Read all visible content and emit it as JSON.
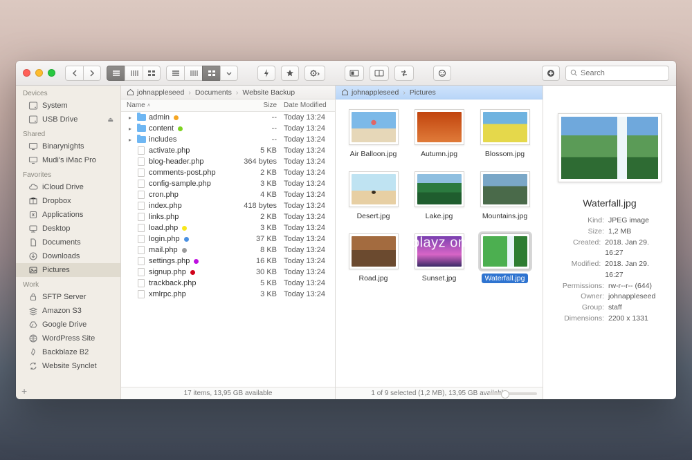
{
  "search": {
    "placeholder": "Search"
  },
  "sidebar": {
    "sections": [
      {
        "label": "Devices",
        "items": [
          {
            "name": "system",
            "label": "System",
            "icon": "drive"
          },
          {
            "name": "usb",
            "label": "USB Drive",
            "icon": "drive",
            "eject": true
          }
        ]
      },
      {
        "label": "Shared",
        "items": [
          {
            "name": "binarynights",
            "label": "Binarynights",
            "icon": "display"
          },
          {
            "name": "mudi-imac",
            "label": "Mudi's iMac Pro",
            "icon": "display"
          }
        ]
      },
      {
        "label": "Favorites",
        "items": [
          {
            "name": "icloud",
            "label": "iCloud Drive",
            "icon": "cloud"
          },
          {
            "name": "dropbox",
            "label": "Dropbox",
            "icon": "box"
          },
          {
            "name": "apps",
            "label": "Applications",
            "icon": "app"
          },
          {
            "name": "desktop",
            "label": "Desktop",
            "icon": "desktop"
          },
          {
            "name": "documents",
            "label": "Documents",
            "icon": "doc"
          },
          {
            "name": "downloads",
            "label": "Downloads",
            "icon": "down"
          },
          {
            "name": "pictures",
            "label": "Pictures",
            "icon": "pic",
            "selected": true
          }
        ]
      },
      {
        "label": "Work",
        "items": [
          {
            "name": "sftp",
            "label": "SFTP Server",
            "icon": "lock"
          },
          {
            "name": "s3",
            "label": "Amazon S3",
            "icon": "stack"
          },
          {
            "name": "gdrive",
            "label": "Google Drive",
            "icon": "gdrive"
          },
          {
            "name": "wp",
            "label": "WordPress Site",
            "icon": "globe"
          },
          {
            "name": "backblaze",
            "label": "Backblaze B2",
            "icon": "flame"
          },
          {
            "name": "synclet",
            "label": "Website Synclet",
            "icon": "sync"
          }
        ]
      }
    ]
  },
  "left_pane": {
    "breadcrumbs": [
      "johnappleseed",
      "Documents",
      "Website Backup"
    ],
    "columns": {
      "name": "Name",
      "size": "Size",
      "date": "Date Modified"
    },
    "rows": [
      {
        "type": "folder",
        "name": "admin",
        "size": "--",
        "date": "Today 13:24",
        "tag": "#f5a623"
      },
      {
        "type": "folder",
        "name": "content",
        "size": "--",
        "date": "Today 13:24",
        "tag": "#7ed321"
      },
      {
        "type": "folder",
        "name": "includes",
        "size": "--",
        "date": "Today 13:24"
      },
      {
        "type": "file",
        "name": "activate.php",
        "size": "5 KB",
        "date": "Today 13:24"
      },
      {
        "type": "file",
        "name": "blog-header.php",
        "size": "364 bytes",
        "date": "Today 13:24"
      },
      {
        "type": "file",
        "name": "comments-post.php",
        "size": "2 KB",
        "date": "Today 13:24"
      },
      {
        "type": "file",
        "name": "config-sample.php",
        "size": "3 KB",
        "date": "Today 13:24"
      },
      {
        "type": "file",
        "name": "cron.php",
        "size": "4 KB",
        "date": "Today 13:24"
      },
      {
        "type": "file",
        "name": "index.php",
        "size": "418 bytes",
        "date": "Today 13:24"
      },
      {
        "type": "file",
        "name": "links.php",
        "size": "2 KB",
        "date": "Today 13:24"
      },
      {
        "type": "file",
        "name": "load.php",
        "size": "3 KB",
        "date": "Today 13:24",
        "tag": "#f8e71c"
      },
      {
        "type": "file",
        "name": "login.php",
        "size": "37 KB",
        "date": "Today 13:24",
        "tag": "#4a90e2"
      },
      {
        "type": "file",
        "name": "mail.php",
        "size": "8 KB",
        "date": "Today 13:24",
        "tag": "#9b9b9b"
      },
      {
        "type": "file",
        "name": "settings.php",
        "size": "16 KB",
        "date": "Today 13:24",
        "tag": "#bd10e0"
      },
      {
        "type": "file",
        "name": "signup.php",
        "size": "30 KB",
        "date": "Today 13:24",
        "tag": "#d0021b"
      },
      {
        "type": "file",
        "name": "trackback.php",
        "size": "5 KB",
        "date": "Today 13:24"
      },
      {
        "type": "file",
        "name": "xmlrpc.php",
        "size": "3 KB",
        "date": "Today 13:24"
      }
    ],
    "status": "17 items, 13,95 GB available"
  },
  "mid_pane": {
    "breadcrumbs": [
      "johnappleseed",
      "Pictures"
    ],
    "items": [
      {
        "name": "Air Balloon.jpg",
        "bg": "linear-gradient(180deg,#7cb9e8 55%,#e6d7b8 55%)",
        "accent": "radial-gradient(circle at 50% 35%, #e06666 0 8%, transparent 9%)"
      },
      {
        "name": "Autumn.jpg",
        "bg": "linear-gradient(180deg,#c1440e,#e07b39)"
      },
      {
        "name": "Blossom.jpg",
        "bg": "linear-gradient(180deg,#6fb3e0 40%,#e5d84b 40%)"
      },
      {
        "name": "Desert.jpg",
        "bg": "linear-gradient(180deg,#bfe3f2 55%,#e7cfa3 55%)",
        "accent": "radial-gradient(ellipse at 50% 60%, #3a2e1f 0 6%, transparent 7%)"
      },
      {
        "name": "Lake.jpg",
        "bg": "linear-gradient(180deg,#8fbfe0 30%,#2b7a3f 30% 60%,#1f5d2e 60%)"
      },
      {
        "name": "Mountains.jpg",
        "bg": "linear-gradient(180deg,#7aa7c7 40%,#4a6a4a 40%)"
      },
      {
        "name": "Road.jpg",
        "bg": "linear-gradient(180deg,#a36b3f 45%,#6b4a2f 45%)"
      },
      {
        "name": "Sunset.jpg",
        "bg": "linear-gradient(180deg,#7a3fb0,#d765c6 60%,#3a2a66)"
      },
      {
        "name": "Waterfall.jpg",
        "bg": "linear-gradient(90deg,#4caf50 55%,#e8f4f8 55% 70%,#2e7d32 70%)",
        "selected": true
      }
    ],
    "status": "1 of 9 selected (1,2 MB), 13,95 GB available",
    "watermark": "iplayz   om"
  },
  "preview": {
    "bg": "linear-gradient(180deg,#6fa8dc 30%,#5b9b57 30% 65%,#2e6b33 65%)",
    "accent": "linear-gradient(90deg, transparent 58%, #eef6fa 58% 68%, transparent 68%)",
    "title": "Waterfall.jpg",
    "meta": [
      {
        "k": "Kind:",
        "v": "JPEG image"
      },
      {
        "k": "Size:",
        "v": "1,2 MB"
      },
      {
        "k": "Created:",
        "v": "2018. Jan 29. 16:27"
      },
      {
        "k": "Modified:",
        "v": "2018. Jan 29. 16:27"
      },
      {
        "k": "Permissions:",
        "v": "rw-r--r-- (644)"
      },
      {
        "k": "Owner:",
        "v": "johnappleseed"
      },
      {
        "k": "Group:",
        "v": "staff"
      },
      {
        "k": "Dimensions:",
        "v": "2200 x 1331"
      }
    ]
  }
}
